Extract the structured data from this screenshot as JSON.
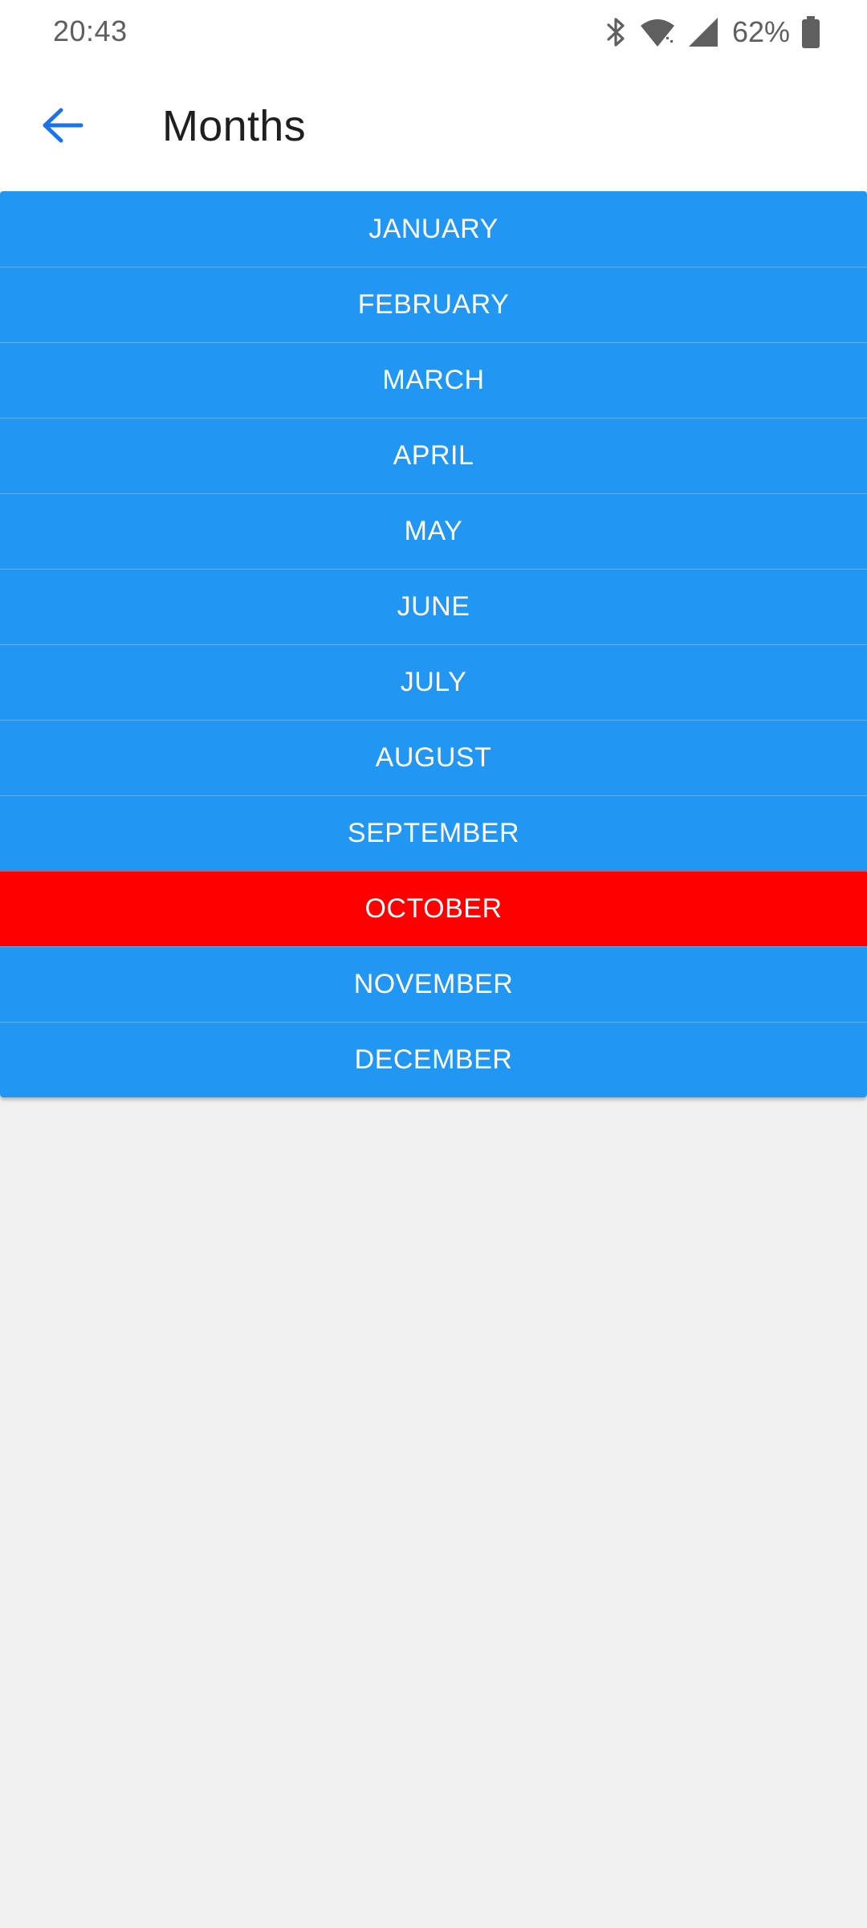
{
  "status_bar": {
    "time": "20:43",
    "battery_percent": "62%",
    "icons": [
      "bluetooth-icon",
      "wifi-icon",
      "cellular-signal-icon",
      "battery-icon"
    ],
    "color": "#5f5f5f"
  },
  "app_bar": {
    "back_icon": "arrow-left-icon",
    "title": "Months",
    "accent_color": "#1a73e8"
  },
  "months": {
    "button_color": "#2196f3",
    "active_color": "#ff0000",
    "active_index": 9,
    "items": [
      {
        "label": "JANUARY"
      },
      {
        "label": "FEBRUARY"
      },
      {
        "label": "MARCH"
      },
      {
        "label": "APRIL"
      },
      {
        "label": "MAY"
      },
      {
        "label": "JUNE"
      },
      {
        "label": "JULY"
      },
      {
        "label": "AUGUST"
      },
      {
        "label": "SEPTEMBER"
      },
      {
        "label": "OCTOBER"
      },
      {
        "label": "NOVEMBER"
      },
      {
        "label": "DECEMBER"
      }
    ]
  }
}
